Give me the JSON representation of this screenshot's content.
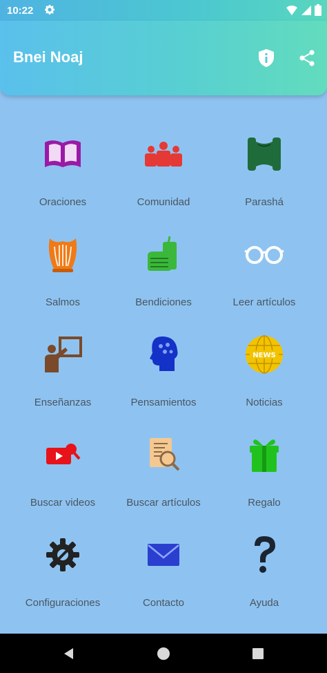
{
  "status": {
    "time": "10:22"
  },
  "app_bar": {
    "title": "Bnei Noaj"
  },
  "tiles": [
    {
      "label": "Oraciones",
      "icon": "book-icon",
      "color": "#9a1aa6"
    },
    {
      "label": "Comunidad",
      "icon": "community-icon",
      "color": "#e53935"
    },
    {
      "label": "Parashá",
      "icon": "torah-scroll-icon",
      "color": "#1f6b3a"
    },
    {
      "label": "Salmos",
      "icon": "harp-icon",
      "color": "#f07a17"
    },
    {
      "label": "Bendiciones",
      "icon": "food-drink-icon",
      "color": "#3bb83b"
    },
    {
      "label": "Leer artículos",
      "icon": "glasses-icon",
      "color": "#ffffff"
    },
    {
      "label": "Enseñanzas",
      "icon": "teacher-icon",
      "color": "#7a4a2a"
    },
    {
      "label": "Pensamientos",
      "icon": "brain-head-icon",
      "color": "#1431c8"
    },
    {
      "label": "Noticias",
      "icon": "news-globe-icon",
      "color": "#f2c400"
    },
    {
      "label": "Buscar videos",
      "icon": "video-search-icon",
      "color": "#e8121a"
    },
    {
      "label": "Buscar artículos",
      "icon": "document-search-icon",
      "color": "#f5c891"
    },
    {
      "label": "Regalo",
      "icon": "gift-icon",
      "color": "#22c21e"
    },
    {
      "label": "Configuraciones",
      "icon": "settings-gear-icon",
      "color": "#222222"
    },
    {
      "label": "Contacto",
      "icon": "envelope-icon",
      "color": "#2a3fd0"
    },
    {
      "label": "Ayuda",
      "icon": "question-mark-icon",
      "color": "#1b2431"
    }
  ]
}
